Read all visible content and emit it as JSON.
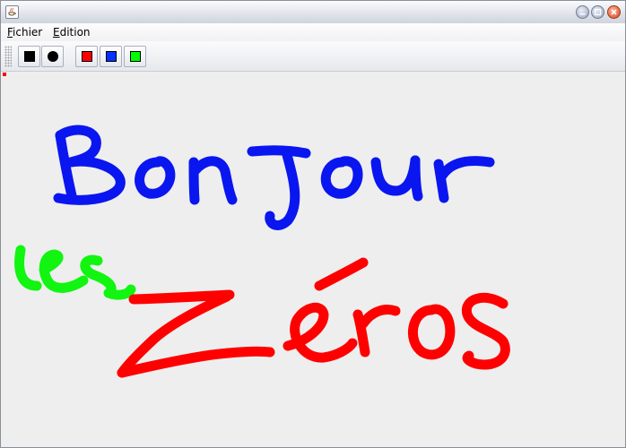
{
  "window": {
    "icon": "java-coffee-cup-icon",
    "controls": [
      "minimize-icon",
      "maximize-icon",
      "close-icon"
    ]
  },
  "menubar": {
    "fichier": {
      "mnemonic": "F",
      "rest": "ichier"
    },
    "edition": {
      "mnemonic": "E",
      "rest": "dition"
    }
  },
  "toolbar": {
    "shapes": [
      "square",
      "circle"
    ],
    "colors": {
      "red": "#ff0000",
      "blue": "#0033ff",
      "green": "#00ff00"
    }
  },
  "canvas": {
    "background": "#eeeeee",
    "stroke_colors": {
      "blue": "#0a16f0",
      "green": "#11f511",
      "red": "#ff0000"
    }
  }
}
